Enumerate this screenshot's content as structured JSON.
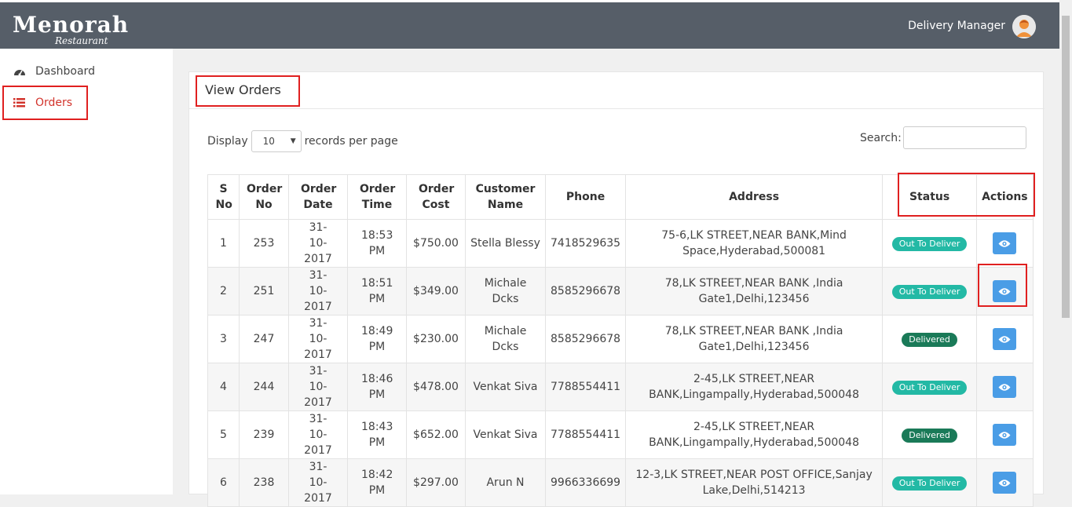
{
  "header": {
    "logo_main": "Menorah",
    "logo_sub": "Restaurant",
    "user_label": "Delivery Manager"
  },
  "sidebar": {
    "items": [
      {
        "label": "Dashboard",
        "icon": "dashboard-icon"
      },
      {
        "label": "Orders",
        "icon": "list-icon",
        "active": true
      }
    ]
  },
  "panel": {
    "title": "View Orders",
    "display_label": "Display",
    "page_size": "10",
    "records_label": "records per page",
    "search_label": "Search:",
    "search_value": ""
  },
  "table": {
    "headers": [
      "S No",
      "Order No",
      "Order Date",
      "Order Time",
      "Order Cost",
      "Customer Name",
      "Phone",
      "Address",
      "Status",
      "Actions"
    ],
    "rows": [
      {
        "sno": "1",
        "order_no": "253",
        "date": "31-10-2017",
        "time": "18:53 PM",
        "cost": "$750.00",
        "customer": "Stella Blessy",
        "phone": "7418529635",
        "address_l1": "75-6,LK STREET,NEAR BANK,Mind",
        "address_l2": "Space,Hyderabad,500081",
        "status": "Out To Deliver",
        "status_type": "out"
      },
      {
        "sno": "2",
        "order_no": "251",
        "date": "31-10-2017",
        "time": "18:51 PM",
        "cost": "$349.00",
        "customer": "Michale Dcks",
        "phone": "8585296678",
        "address_l1": "78,LK STREET,NEAR BANK ,India",
        "address_l2": "Gate1,Delhi,123456",
        "status": "Out To Deliver",
        "status_type": "out"
      },
      {
        "sno": "3",
        "order_no": "247",
        "date": "31-10-2017",
        "time": "18:49 PM",
        "cost": "$230.00",
        "customer": "Michale Dcks",
        "phone": "8585296678",
        "address_l1": "78,LK STREET,NEAR BANK ,India",
        "address_l2": "Gate1,Delhi,123456",
        "status": "Delivered",
        "status_type": "done"
      },
      {
        "sno": "4",
        "order_no": "244",
        "date": "31-10-2017",
        "time": "18:46 PM",
        "cost": "$478.00",
        "customer": "Venkat Siva",
        "phone": "7788554411",
        "address_l1": "2-45,LK STREET,NEAR",
        "address_l2": "BANK,Lingampally,Hyderabad,500048",
        "status": "Out To Deliver",
        "status_type": "out"
      },
      {
        "sno": "5",
        "order_no": "239",
        "date": "31-10-2017",
        "time": "18:43 PM",
        "cost": "$652.00",
        "customer": "Venkat Siva",
        "phone": "7788554411",
        "address_l1": "2-45,LK STREET,NEAR",
        "address_l2": "BANK,Lingampally,Hyderabad,500048",
        "status": "Delivered",
        "status_type": "done"
      },
      {
        "sno": "6",
        "order_no": "238",
        "date": "31-10-2017",
        "time": "18:42 PM",
        "cost": "$297.00",
        "customer": "Arun N",
        "phone": "9966336699",
        "address_l1": "12-3,LK STREET,NEAR POST OFFICE,Sanjay",
        "address_l2": "Lake,Delhi,514213",
        "status": "Out To Deliver",
        "status_type": "out"
      }
    ]
  },
  "colors": {
    "header_bg": "#565e68",
    "active": "#d2332b",
    "badge_out": "#23b9a5",
    "badge_delivered": "#1a7a58",
    "view_button": "#4a9de6",
    "highlight": "#e02020"
  }
}
